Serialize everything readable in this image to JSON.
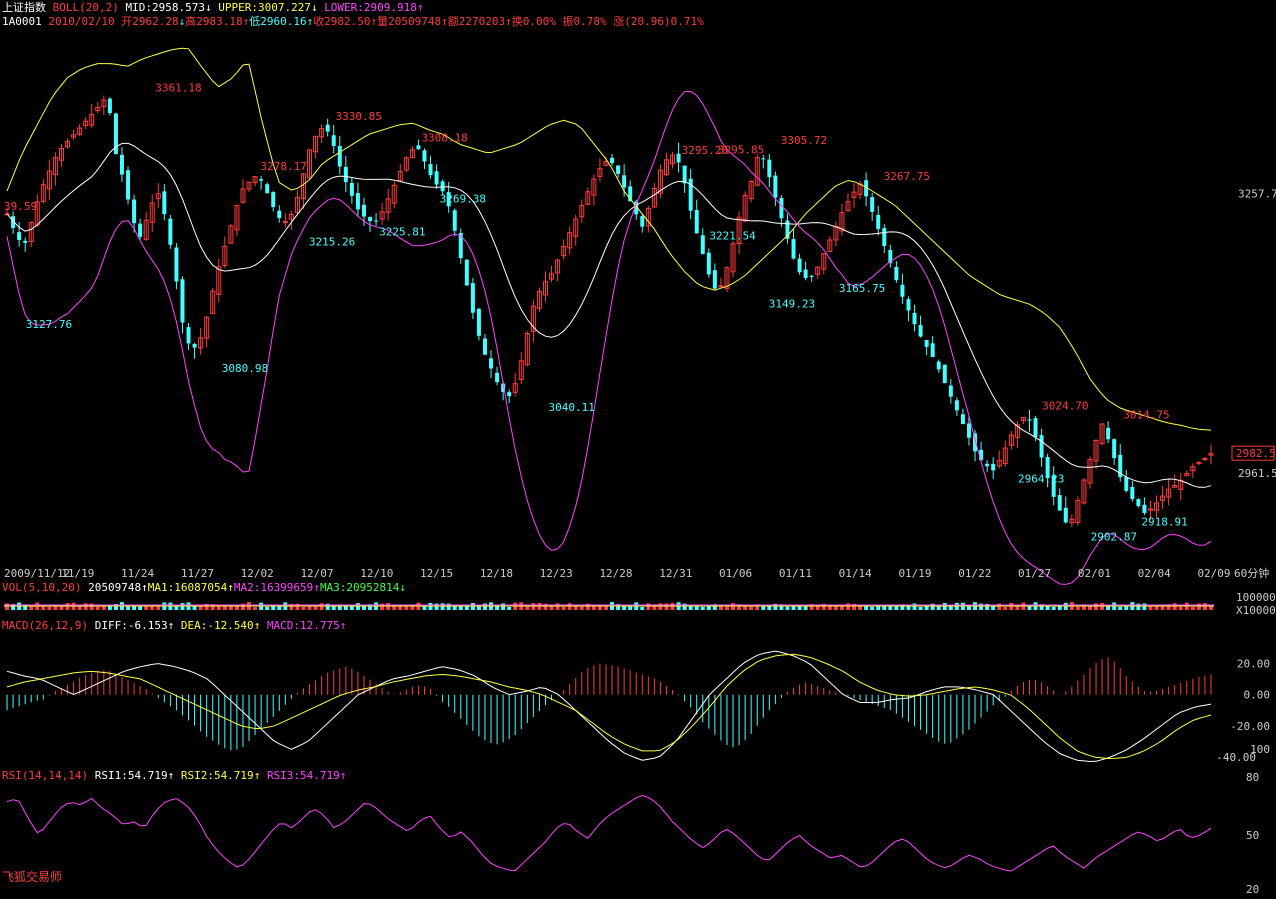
{
  "header": {
    "line1": {
      "index_name": "上证指数",
      "boll_label": "BOLL(20,2)",
      "mid": "MID:2958.573",
      "mid_arrow": "↓",
      "upper": "UPPER:3007.227",
      "upper_arrow": "↓",
      "lower": "LOWER:2909.918",
      "lower_arrow": "↑"
    },
    "line2": {
      "code": "1A0001",
      "date": "2010/02/10",
      "open": "开2962.28",
      "open_arrow": "↓",
      "high": "高2983.18",
      "high_arrow": "↑",
      "low": "低2960.16",
      "low_arrow": "↑",
      "close": "收2982.50",
      "close_arrow": "↑",
      "volume": "量20509748",
      "volume_arrow": "↑",
      "amount": "额2270203",
      "amount_arrow": "↑",
      "turnover": "换0.00%",
      "amplitude": "振0.78%",
      "change": "涨(20.96)0.71%"
    }
  },
  "colors": {
    "up": "#ff3c3c",
    "down": "#44ffff",
    "upper_band": "#ffff44",
    "mid_band": "#ffffff",
    "lower_band": "#ff44ff",
    "axis": "#cccccc",
    "price_tag": "#ff3c3c"
  },
  "chart_data": [
    {
      "type": "candlestick",
      "name": "price",
      "y_ticks": [
        "3257.7",
        "2961.5"
      ],
      "last_price_tag": "2982.5",
      "x_ticks": [
        "2009/11/12",
        "11/19",
        "11/24",
        "11/27",
        "12/02",
        "12/07",
        "12/10",
        "12/15",
        "12/18",
        "12/23",
        "12/28",
        "12/31",
        "01/06",
        "01/11",
        "01/14",
        "01/19",
        "01/22",
        "01/27",
        "02/01",
        "02/04",
        "02/09"
      ],
      "period_label": "60分钟",
      "ylim": [
        2880,
        3420
      ],
      "annotations": [
        {
          "text": "39.59",
          "value": 3236,
          "kind": "high",
          "at": 0.0
        },
        {
          "text": "3127.76",
          "value": 3127.76,
          "kind": "low",
          "at": 0.018
        },
        {
          "text": "3361.18",
          "value": 3361.18,
          "kind": "high",
          "at": 0.125
        },
        {
          "text": "3080.98",
          "value": 3080.98,
          "kind": "low",
          "at": 0.18
        },
        {
          "text": "3278.17",
          "value": 3278.17,
          "kind": "high",
          "at": 0.212
        },
        {
          "text": "3215.26",
          "value": 3215.26,
          "kind": "low",
          "at": 0.252
        },
        {
          "text": "3330.85",
          "value": 3330.85,
          "kind": "high",
          "at": 0.274
        },
        {
          "text": "3225.81",
          "value": 3225.81,
          "kind": "low",
          "at": 0.31
        },
        {
          "text": "3308.18",
          "value": 3308.18,
          "kind": "high",
          "at": 0.345
        },
        {
          "text": "3269.38",
          "value": 3260.5,
          "kind": "low",
          "at": 0.36
        },
        {
          "text": "3040.11",
          "value": 3040.11,
          "kind": "low",
          "at": 0.45
        },
        {
          "text": "3295.28",
          "value": 3295.28,
          "kind": "high",
          "at": 0.56
        },
        {
          "text": "3295.85",
          "value": 3295.85,
          "kind": "high",
          "at": 0.59
        },
        {
          "text": "3221.54",
          "value": 3221.54,
          "kind": "low",
          "at": 0.583
        },
        {
          "text": "3305.72",
          "value": 3305.72,
          "kind": "high",
          "at": 0.642
        },
        {
          "text": "3149.23",
          "value": 3149.23,
          "kind": "low",
          "at": 0.632
        },
        {
          "text": "3165.75",
          "value": 3165.75,
          "kind": "low",
          "at": 0.69
        },
        {
          "text": "3267.75",
          "value": 3267.75,
          "kind": "high",
          "at": 0.727
        },
        {
          "text": "3024.70",
          "value": 3024.7,
          "kind": "high",
          "at": 0.858
        },
        {
          "text": "2964.23",
          "value": 2964.23,
          "kind": "low",
          "at": 0.838
        },
        {
          "text": "3014.75",
          "value": 3014.75,
          "kind": "high",
          "at": 0.925
        },
        {
          "text": "2902.87",
          "value": 2902.87,
          "kind": "low",
          "at": 0.898
        },
        {
          "text": "2918.91",
          "value": 2918.91,
          "kind": "low",
          "at": 0.94
        }
      ],
      "close_path": [
        3236,
        3215,
        3200,
        3230,
        3260,
        3280,
        3300,
        3310,
        3320,
        3330,
        3340,
        3350,
        3361,
        3300,
        3270,
        3230,
        3210,
        3240,
        3260,
        3230,
        3180,
        3120,
        3090,
        3100,
        3130,
        3170,
        3200,
        3230,
        3260,
        3270,
        3278,
        3260,
        3240,
        3225,
        3235,
        3260,
        3300,
        3320,
        3330,
        3310,
        3280,
        3260,
        3240,
        3230,
        3226,
        3240,
        3260,
        3280,
        3300,
        3308,
        3290,
        3270,
        3262,
        3240,
        3200,
        3160,
        3120,
        3090,
        3070,
        3050,
        3042,
        3060,
        3100,
        3140,
        3160,
        3170,
        3190,
        3210,
        3230,
        3250,
        3270,
        3285,
        3295,
        3280,
        3260,
        3240,
        3222,
        3250,
        3280,
        3295,
        3300,
        3270,
        3230,
        3200,
        3170,
        3150,
        3175,
        3210,
        3250,
        3270,
        3305,
        3280,
        3250,
        3220,
        3190,
        3170,
        3166,
        3180,
        3200,
        3220,
        3240,
        3255,
        3268,
        3250,
        3225,
        3200,
        3175,
        3150,
        3130,
        3110,
        3095,
        3080,
        3060,
        3040,
        3020,
        3000,
        2980,
        2970,
        2964,
        2980,
        3000,
        3015,
        3024,
        3000,
        2970,
        2940,
        2920,
        2903,
        2930,
        2960,
        2990,
        3014,
        2990,
        2960,
        2940,
        2930,
        2919,
        2925,
        2935,
        2945,
        2950,
        2960,
        2970,
        2975,
        2982
      ],
      "upper_band": [
        3260,
        3300,
        3330,
        3360,
        3380,
        3390,
        3395,
        3395,
        3392,
        3400,
        3405,
        3410,
        3412,
        3390,
        3370,
        3380,
        3400,
        3330,
        3270,
        3260,
        3270,
        3290,
        3300,
        3310,
        3320,
        3325,
        3330,
        3332,
        3325,
        3320,
        3310,
        3305,
        3300,
        3305,
        3310,
        3320,
        3330,
        3335,
        3330,
        3310,
        3290,
        3260,
        3240,
        3220,
        3195,
        3175,
        3160,
        3155,
        3160,
        3170,
        3185,
        3200,
        3215,
        3235,
        3250,
        3265,
        3272,
        3265,
        3255,
        3245,
        3230,
        3215,
        3200,
        3185,
        3170,
        3160,
        3150,
        3145,
        3140,
        3130,
        3115,
        3090,
        3060,
        3040,
        3030,
        3025,
        3020,
        3015,
        3012,
        3008,
        3007
      ]
    },
    {
      "type": "bar",
      "name": "VOL(5,10,20)",
      "legend": {
        "label": "VOL(5,10,20)",
        "value": "20509748",
        "ma1": "MA1:16087054",
        "ma2": "MA2:16399659",
        "ma3": "MA3:20952814",
        "ma1_arrow": "↑",
        "ma2_arrow": "↑",
        "ma3_arrow": "↓"
      },
      "y_ticks": [
        "100000",
        "X10000"
      ]
    },
    {
      "type": "line",
      "name": "MACD(26,12,9)",
      "legend": {
        "label": "MACD(26,12,9)",
        "diff": "DIFF:-6.153",
        "diff_arrow": "↑",
        "dea": "DEA:-12.540",
        "dea_arrow": "↑",
        "macd": "MACD:12.775",
        "macd_arrow": "↑"
      },
      "y_ticks": [
        "20.00",
        "0.00",
        "-20.00",
        "-40.00",
        "100"
      ],
      "ylim": [
        -45,
        35
      ],
      "macd_bars": [
        -10,
        -8,
        -6,
        -4,
        -3,
        2,
        5,
        8,
        12,
        14,
        16,
        15,
        12,
        9,
        6,
        3,
        -2,
        -6,
        -10,
        -15,
        -20,
        -26,
        -30,
        -34,
        -36,
        -34,
        -28,
        -22,
        -16,
        -10,
        -4,
        2,
        6,
        10,
        14,
        16,
        18,
        16,
        12,
        8,
        4,
        0,
        2,
        5,
        6,
        4,
        -3,
        -8,
        -14,
        -20,
        -26,
        -30,
        -32,
        -30,
        -26,
        -20,
        -14,
        -8,
        -3,
        2,
        8,
        14,
        18,
        20,
        19,
        18,
        16,
        14,
        12,
        10,
        6,
        2,
        -4,
        -10,
        -18,
        -24,
        -30,
        -34,
        -32,
        -26,
        -18,
        -10,
        -4,
        2,
        6,
        8,
        6,
        4,
        2,
        0,
        -2,
        -4,
        -6,
        -8,
        -10,
        -14,
        -18,
        -22,
        -26,
        -30,
        -32,
        -28,
        -24,
        -18,
        -12,
        -6,
        -2,
        4,
        8,
        10,
        8,
        4,
        0,
        4,
        10,
        16,
        22,
        24,
        20,
        12,
        6,
        2,
        2,
        4,
        6,
        8,
        10,
        12,
        13
      ],
      "diff": [
        15,
        12,
        10,
        5,
        0,
        5,
        10,
        15,
        18,
        20,
        18,
        15,
        10,
        0,
        -10,
        -20,
        -30,
        -35,
        -30,
        -20,
        -10,
        0,
        5,
        10,
        12,
        15,
        18,
        16,
        12,
        5,
        0,
        2,
        5,
        0,
        -10,
        -20,
        -30,
        -38,
        -42,
        -40,
        -30,
        -15,
        0,
        10,
        20,
        26,
        28,
        25,
        20,
        10,
        0,
        -5,
        -5,
        -3,
        -2,
        2,
        5,
        5,
        3,
        0,
        -10,
        -20,
        -30,
        -38,
        -42,
        -43,
        -40,
        -35,
        -28,
        -20,
        -12,
        -8,
        -6
      ],
      "dea": [
        5,
        8,
        10,
        12,
        14,
        15,
        14,
        12,
        10,
        5,
        0,
        -5,
        -10,
        -15,
        -20,
        -22,
        -20,
        -15,
        -10,
        -5,
        0,
        3,
        5,
        8,
        10,
        12,
        13,
        12,
        10,
        8,
        5,
        3,
        0,
        -5,
        -10,
        -18,
        -26,
        -32,
        -36,
        -36,
        -30,
        -20,
        -8,
        5,
        15,
        22,
        25,
        26,
        24,
        20,
        15,
        8,
        3,
        0,
        -1,
        0,
        2,
        4,
        5,
        3,
        0,
        -8,
        -18,
        -28,
        -36,
        -40,
        -41,
        -40,
        -36,
        -30,
        -22,
        -16,
        -13
      ]
    },
    {
      "type": "line",
      "name": "RSI(14,14,14)",
      "legend": {
        "label": "RSI(14,14,14)",
        "rsi1": "RSI1:54.719",
        "rsi1_arrow": "↑",
        "rsi2": "RSI2:54.719",
        "rsi2_arrow": "↑",
        "rsi3": "RSI3:54.719",
        "rsi3_arrow": "↑"
      },
      "y_ticks": [
        "80",
        "50",
        "20"
      ],
      "ylim": [
        20,
        80
      ],
      "values": [
        70,
        72,
        60,
        50,
        58,
        66,
        70,
        68,
        72,
        66,
        62,
        56,
        58,
        54,
        64,
        70,
        72,
        68,
        60,
        48,
        40,
        34,
        30,
        36,
        44,
        52,
        58,
        54,
        60,
        66,
        62,
        54,
        58,
        64,
        70,
        66,
        60,
        56,
        52,
        58,
        62,
        54,
        48,
        52,
        46,
        38,
        32,
        30,
        28,
        34,
        40,
        46,
        54,
        58,
        52,
        48,
        56,
        62,
        66,
        70,
        74,
        72,
        66,
        58,
        52,
        46,
        42,
        48,
        54,
        50,
        44,
        38,
        34,
        40,
        46,
        50,
        44,
        40,
        36,
        38,
        34,
        30,
        34,
        40,
        46,
        48,
        42,
        36,
        32,
        30,
        34,
        38,
        36,
        32,
        30,
        28,
        32,
        36,
        40,
        44,
        38,
        34,
        30,
        36,
        40,
        44,
        48,
        52,
        50,
        46,
        50,
        54,
        48,
        50,
        54
      ]
    }
  ],
  "footer": {
    "brand": "飞狐交易师"
  }
}
